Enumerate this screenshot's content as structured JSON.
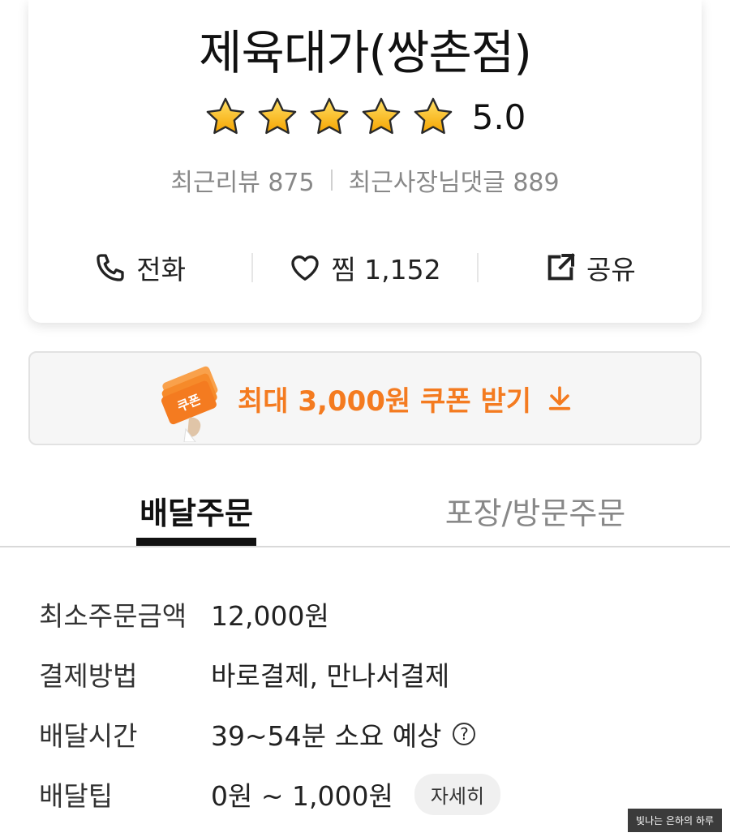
{
  "store": {
    "name": "제육대가(쌍촌점)",
    "rating": 5.0,
    "rating_text": "5.0",
    "star_count": 5,
    "star_color": "#FFC107",
    "reviews_label": "최근리뷰 875",
    "owner_replies_label": "최근사장님댓글 889"
  },
  "actions": {
    "call": {
      "label": "전화",
      "icon": "phone-icon"
    },
    "like": {
      "label": "찜 1,152",
      "icon": "heart-icon"
    },
    "share": {
      "label": "공유",
      "icon": "share-icon"
    }
  },
  "coupon": {
    "label": "최대 3,000원 쿠폰 받기",
    "badge_text": "쿠폰",
    "color": "#F47B20",
    "icon": "download-arrow-icon"
  },
  "tabs": {
    "delivery": "배달주문",
    "takeout": "포장/방문주문",
    "active": "delivery"
  },
  "info": {
    "min_order": {
      "label": "최소주문금액",
      "value": "12,000원"
    },
    "payment": {
      "label": "결제방법",
      "value": "바로결제, 만나서결제"
    },
    "delivery_time": {
      "label": "배달시간",
      "value": "39~54분 소요 예상",
      "help": "?"
    },
    "delivery_tip": {
      "label": "배달팁",
      "value": "0원 ~ 1,000원",
      "detail_button": "자세히"
    }
  },
  "watermark": "빛나는 은하의 하루"
}
